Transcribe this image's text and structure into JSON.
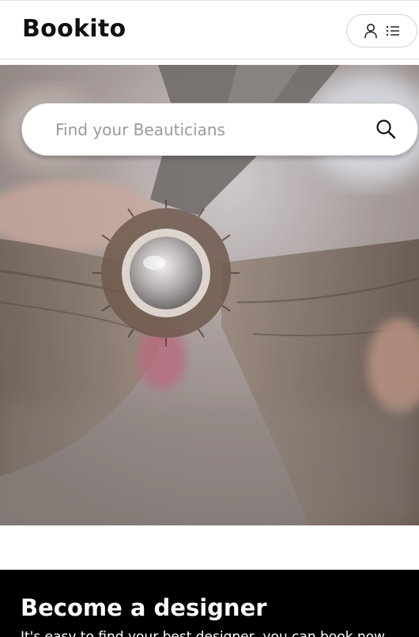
{
  "header": {
    "logo": "Bookito",
    "icons": [
      "user-icon",
      "list-icon"
    ]
  },
  "search": {
    "placeholder": "Find your Beauticians",
    "icon": "search-icon"
  },
  "hero": {
    "image": "hair-styling-round-brush-photo"
  },
  "designer_section": {
    "title": "Become a designer",
    "text": "It's easy to find your best designer, you can book now"
  },
  "colors": {
    "text": "#111111",
    "footer_bg": "#000000",
    "footer_text": "#ffffff",
    "placeholder": "#9a9a9a"
  }
}
